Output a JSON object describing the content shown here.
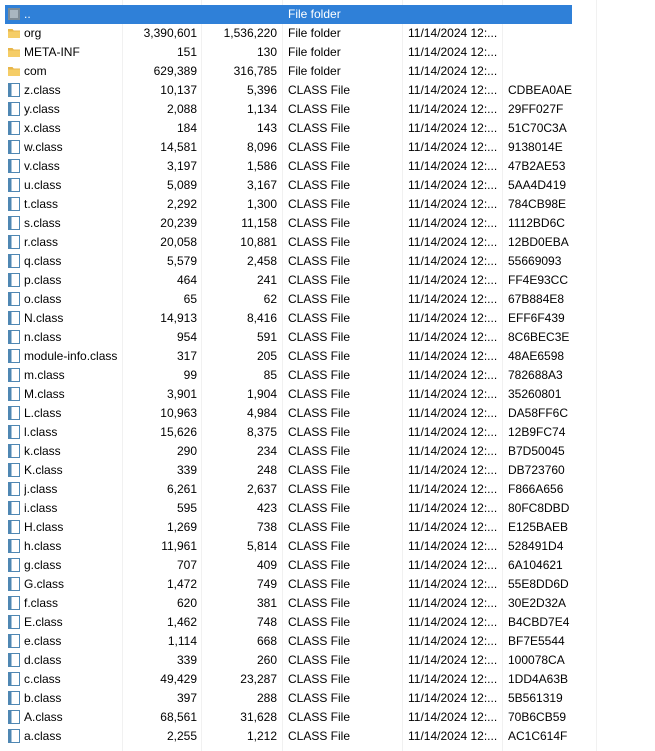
{
  "colors": {
    "selection": "#2f80d8",
    "folder_icon": "#e8b64a",
    "file_icon": "#4f87b3"
  },
  "rows": [
    {
      "name": "..",
      "size": "",
      "packed": "",
      "type": "File folder",
      "modified": "",
      "crc": "",
      "icon": "parent-folder-icon",
      "selected": true
    },
    {
      "name": "org",
      "size": "3,390,601",
      "packed": "1,536,220",
      "type": "File folder",
      "modified": "11/14/2024 12:...",
      "crc": "",
      "icon": "folder-icon"
    },
    {
      "name": "META-INF",
      "size": "151",
      "packed": "130",
      "type": "File folder",
      "modified": "11/14/2024 12:...",
      "crc": "",
      "icon": "folder-icon"
    },
    {
      "name": "com",
      "size": "629,389",
      "packed": "316,785",
      "type": "File folder",
      "modified": "11/14/2024 12:...",
      "crc": "",
      "icon": "folder-icon"
    },
    {
      "name": "z.class",
      "size": "10,137",
      "packed": "5,396",
      "type": "CLASS File",
      "modified": "11/14/2024 12:...",
      "crc": "CDBEA0AE",
      "icon": "file-icon"
    },
    {
      "name": "y.class",
      "size": "2,088",
      "packed": "1,134",
      "type": "CLASS File",
      "modified": "11/14/2024 12:...",
      "crc": "29FF027F",
      "icon": "file-icon"
    },
    {
      "name": "x.class",
      "size": "184",
      "packed": "143",
      "type": "CLASS File",
      "modified": "11/14/2024 12:...",
      "crc": "51C70C3A",
      "icon": "file-icon"
    },
    {
      "name": "w.class",
      "size": "14,581",
      "packed": "8,096",
      "type": "CLASS File",
      "modified": "11/14/2024 12:...",
      "crc": "9138014E",
      "icon": "file-icon"
    },
    {
      "name": "v.class",
      "size": "3,197",
      "packed": "1,586",
      "type": "CLASS File",
      "modified": "11/14/2024 12:...",
      "crc": "47B2AE53",
      "icon": "file-icon"
    },
    {
      "name": "u.class",
      "size": "5,089",
      "packed": "3,167",
      "type": "CLASS File",
      "modified": "11/14/2024 12:...",
      "crc": "5AA4D419",
      "icon": "file-icon"
    },
    {
      "name": "t.class",
      "size": "2,292",
      "packed": "1,300",
      "type": "CLASS File",
      "modified": "11/14/2024 12:...",
      "crc": "784CB98E",
      "icon": "file-icon"
    },
    {
      "name": "s.class",
      "size": "20,239",
      "packed": "11,158",
      "type": "CLASS File",
      "modified": "11/14/2024 12:...",
      "crc": "1112BD6C",
      "icon": "file-icon"
    },
    {
      "name": "r.class",
      "size": "20,058",
      "packed": "10,881",
      "type": "CLASS File",
      "modified": "11/14/2024 12:...",
      "crc": "12BD0EBA",
      "icon": "file-icon"
    },
    {
      "name": "q.class",
      "size": "5,579",
      "packed": "2,458",
      "type": "CLASS File",
      "modified": "11/14/2024 12:...",
      "crc": "55669093",
      "icon": "file-icon"
    },
    {
      "name": "p.class",
      "size": "464",
      "packed": "241",
      "type": "CLASS File",
      "modified": "11/14/2024 12:...",
      "crc": "FF4E93CC",
      "icon": "file-icon"
    },
    {
      "name": "o.class",
      "size": "65",
      "packed": "62",
      "type": "CLASS File",
      "modified": "11/14/2024 12:...",
      "crc": "67B884E8",
      "icon": "file-icon"
    },
    {
      "name": "N.class",
      "size": "14,913",
      "packed": "8,416",
      "type": "CLASS File",
      "modified": "11/14/2024 12:...",
      "crc": "EFF6F439",
      "icon": "file-icon"
    },
    {
      "name": "n.class",
      "size": "954",
      "packed": "591",
      "type": "CLASS File",
      "modified": "11/14/2024 12:...",
      "crc": "8C6BEC3E",
      "icon": "file-icon"
    },
    {
      "name": "module-info.class",
      "size": "317",
      "packed": "205",
      "type": "CLASS File",
      "modified": "11/14/2024 12:...",
      "crc": "48AE6598",
      "icon": "file-icon"
    },
    {
      "name": "m.class",
      "size": "99",
      "packed": "85",
      "type": "CLASS File",
      "modified": "11/14/2024 12:...",
      "crc": "782688A3",
      "icon": "file-icon"
    },
    {
      "name": "M.class",
      "size": "3,901",
      "packed": "1,904",
      "type": "CLASS File",
      "modified": "11/14/2024 12:...",
      "crc": "35260801",
      "icon": "file-icon"
    },
    {
      "name": "L.class",
      "size": "10,963",
      "packed": "4,984",
      "type": "CLASS File",
      "modified": "11/14/2024 12:...",
      "crc": "DA58FF6C",
      "icon": "file-icon"
    },
    {
      "name": "l.class",
      "size": "15,626",
      "packed": "8,375",
      "type": "CLASS File",
      "modified": "11/14/2024 12:...",
      "crc": "12B9FC74",
      "icon": "file-icon"
    },
    {
      "name": "k.class",
      "size": "290",
      "packed": "234",
      "type": "CLASS File",
      "modified": "11/14/2024 12:...",
      "crc": "B7D50045",
      "icon": "file-icon"
    },
    {
      "name": "K.class",
      "size": "339",
      "packed": "248",
      "type": "CLASS File",
      "modified": "11/14/2024 12:...",
      "crc": "DB723760",
      "icon": "file-icon"
    },
    {
      "name": "j.class",
      "size": "6,261",
      "packed": "2,637",
      "type": "CLASS File",
      "modified": "11/14/2024 12:...",
      "crc": "F866A656",
      "icon": "file-icon"
    },
    {
      "name": "i.class",
      "size": "595",
      "packed": "423",
      "type": "CLASS File",
      "modified": "11/14/2024 12:...",
      "crc": "80FC8DBD",
      "icon": "file-icon"
    },
    {
      "name": "H.class",
      "size": "1,269",
      "packed": "738",
      "type": "CLASS File",
      "modified": "11/14/2024 12:...",
      "crc": "E125BAEB",
      "icon": "file-icon"
    },
    {
      "name": "h.class",
      "size": "11,961",
      "packed": "5,814",
      "type": "CLASS File",
      "modified": "11/14/2024 12:...",
      "crc": "528491D4",
      "icon": "file-icon"
    },
    {
      "name": "g.class",
      "size": "707",
      "packed": "409",
      "type": "CLASS File",
      "modified": "11/14/2024 12:...",
      "crc": "6A104621",
      "icon": "file-icon"
    },
    {
      "name": "G.class",
      "size": "1,472",
      "packed": "749",
      "type": "CLASS File",
      "modified": "11/14/2024 12:...",
      "crc": "55E8DD6D",
      "icon": "file-icon"
    },
    {
      "name": "f.class",
      "size": "620",
      "packed": "381",
      "type": "CLASS File",
      "modified": "11/14/2024 12:...",
      "crc": "30E2D32A",
      "icon": "file-icon"
    },
    {
      "name": "E.class",
      "size": "1,462",
      "packed": "748",
      "type": "CLASS File",
      "modified": "11/14/2024 12:...",
      "crc": "B4CBD7E4",
      "icon": "file-icon"
    },
    {
      "name": "e.class",
      "size": "1,114",
      "packed": "668",
      "type": "CLASS File",
      "modified": "11/14/2024 12:...",
      "crc": "BF7E5544",
      "icon": "file-icon"
    },
    {
      "name": "d.class",
      "size": "339",
      "packed": "260",
      "type": "CLASS File",
      "modified": "11/14/2024 12:...",
      "crc": "100078CA",
      "icon": "file-icon"
    },
    {
      "name": "c.class",
      "size": "49,429",
      "packed": "23,287",
      "type": "CLASS File",
      "modified": "11/14/2024 12:...",
      "crc": "1DD4A63B",
      "icon": "file-icon"
    },
    {
      "name": "b.class",
      "size": "397",
      "packed": "288",
      "type": "CLASS File",
      "modified": "11/14/2024 12:...",
      "crc": "5B561319",
      "icon": "file-icon"
    },
    {
      "name": "A.class",
      "size": "68,561",
      "packed": "31,628",
      "type": "CLASS File",
      "modified": "11/14/2024 12:...",
      "crc": "70B6CB59",
      "icon": "file-icon"
    },
    {
      "name": "a.class",
      "size": "2,255",
      "packed": "1,212",
      "type": "CLASS File",
      "modified": "11/14/2024 12:...",
      "crc": "AC1C614F",
      "icon": "file-icon"
    }
  ]
}
